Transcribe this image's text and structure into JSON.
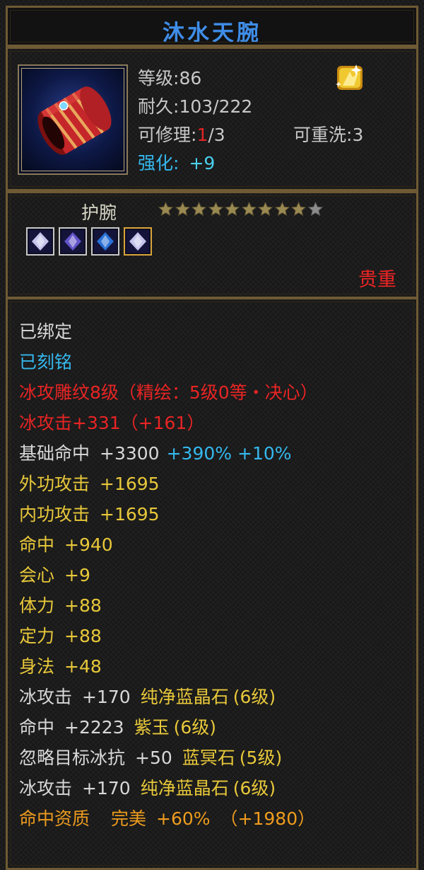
{
  "item": {
    "name": "沐水天腕",
    "type": "护腕",
    "rarity": "贵重",
    "icon": "red-bracer-icon",
    "badge_icon": "gold-sparkle-icon",
    "stars_filled": 9,
    "stars_total": 10
  },
  "info": {
    "level_label": "等级:",
    "level_value": "86",
    "durability_label": "耐久:",
    "durability_value": "103/222",
    "repair_label": "可修理:",
    "repair_current": "1",
    "repair_total": "/3",
    "rewash_label": "可重洗:",
    "rewash_value": "3",
    "enhance_label": "强化:",
    "enhance_value": "+9"
  },
  "gems": [
    {
      "name": "white-gem-icon",
      "color": "#d8d8ff"
    },
    {
      "name": "purple-gem-icon",
      "color": "#6a5ad8"
    },
    {
      "name": "blue-gem-icon",
      "color": "#2a7ae8"
    },
    {
      "name": "white-gem-icon",
      "color": "#d8d8ff"
    }
  ],
  "attributes": {
    "bound": "已绑定",
    "engraved": "已刻铭",
    "carving": "冰攻雕纹8级（精绘：5级0等・决心）",
    "ice_attack_main": "冰攻击+331（+161）",
    "base_hit": {
      "label": "基础命中",
      "v1": "+3300",
      "v2": "+390%",
      "v3": "+10%"
    },
    "stats": [
      {
        "label": "外功攻击",
        "value": "+1695"
      },
      {
        "label": "内功攻击",
        "value": "+1695"
      },
      {
        "label": "命中",
        "value": "+940"
      },
      {
        "label": "会心",
        "value": "+9"
      },
      {
        "label": "体力",
        "value": "+88"
      },
      {
        "label": "定力",
        "value": "+88"
      },
      {
        "label": "身法",
        "value": "+48"
      }
    ],
    "gem_stats": [
      {
        "stat": "冰攻击",
        "value": "+170",
        "gem": "纯净蓝晶石",
        "level": "(6级)"
      },
      {
        "stat": "命中",
        "value": "+2223",
        "gem": "紫玉",
        "level": "(6级)"
      },
      {
        "stat": "忽略目标冰抗",
        "value": "+50",
        "gem": "蓝冥石",
        "level": "(5级)"
      },
      {
        "stat": "冰攻击",
        "value": "+170",
        "gem": "纯净蓝晶石",
        "level": "(6级)"
      }
    ],
    "aptitude": {
      "label": "命中资质",
      "grade": "完美",
      "value": "+60%",
      "bonus": "（+1980）"
    }
  },
  "colors": {
    "title": "#3f8de8",
    "rarity": "#ee2424",
    "enhance": "#35b8ee",
    "stat_gold": "#e8c83a",
    "aptitude_orange": "#ee9c1e",
    "frame": "#6e5a34"
  }
}
